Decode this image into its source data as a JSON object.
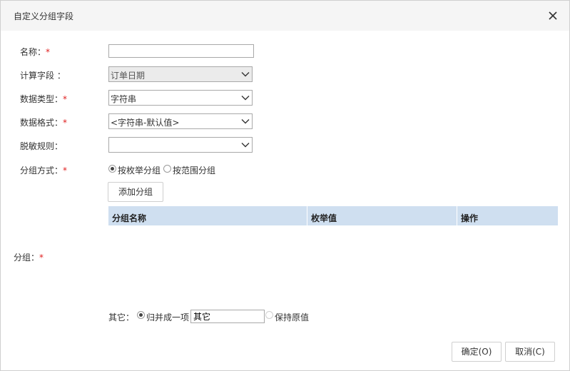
{
  "dialog": {
    "title": "自定义分组字段",
    "close_icon": "close-icon"
  },
  "form": {
    "name": {
      "label": "名称：",
      "required": "*",
      "value": ""
    },
    "calc_field": {
      "label": "计算字段 ：",
      "value": "订单日期"
    },
    "data_type": {
      "label": "数据类型：",
      "required": "*",
      "value": "字符串"
    },
    "data_format": {
      "label": "数据格式：",
      "required": "*",
      "value": "<字符串-默认值>"
    },
    "mask_rule": {
      "label": "脱敏规则：",
      "value": ""
    },
    "group_mode": {
      "label": "分组方式：",
      "required": "*",
      "options": [
        "按枚举分组",
        "按范围分组"
      ],
      "selected": "按枚举分组"
    },
    "add_group_label": "添加分组",
    "grid_columns": [
      "分组名称",
      "枚举值",
      "操作"
    ],
    "group_label": "分组：",
    "group_required": "*",
    "other": {
      "label": "其它：",
      "merge_option": "归并成一项",
      "merge_value": "其它",
      "keep_option": "保持原值"
    }
  },
  "footer": {
    "ok_label": "确定(O)",
    "cancel_label": "取消(C)"
  }
}
